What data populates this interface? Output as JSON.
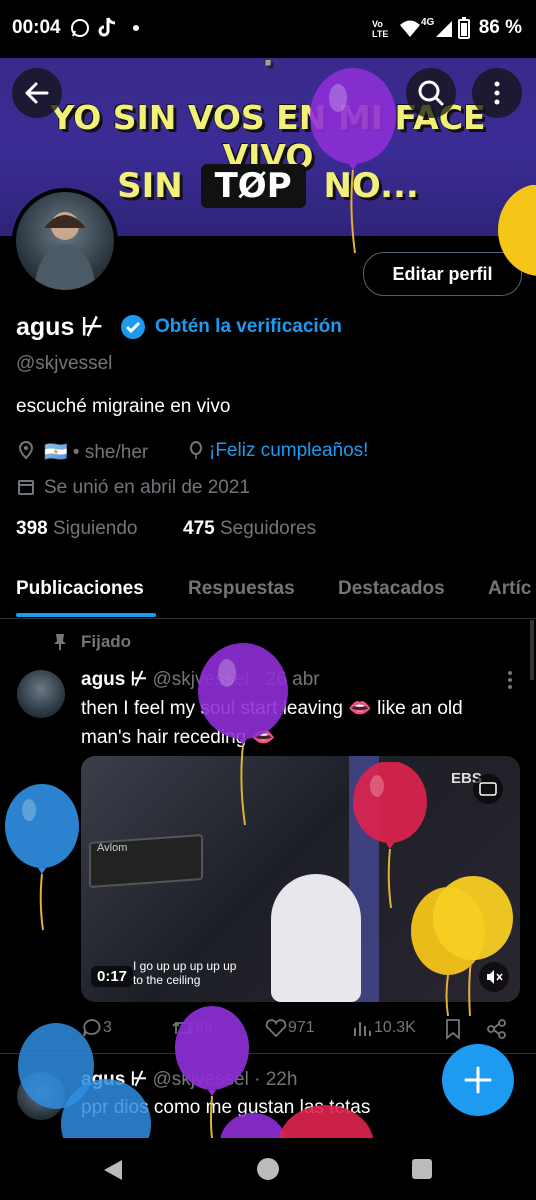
{
  "status_bar": {
    "time": "00:04",
    "network": "4G",
    "battery": "86 %",
    "volte_label": "Vo LTE"
  },
  "banner": {
    "line1": "YO SIN VOS EN MI FACE VIVO",
    "line2a": "SIN",
    "line2b": "TØP",
    "line2c": "NO..."
  },
  "profile": {
    "display_name": "agus ⊬",
    "verification_cta": "Obtén la verificación",
    "handle": "@skjvessel",
    "bio": "escuché migraine en vivo",
    "location": "🇦🇷 • she/her",
    "birthday": "¡Feliz cumpleaños!",
    "joined": "Se unió en abril de 2021",
    "following_count": "398",
    "following_label": "Siguiendo",
    "followers_count": "475",
    "followers_label": "Seguidores",
    "edit_label": "Editar perfil"
  },
  "tabs": [
    {
      "label": "Publicaciones"
    },
    {
      "label": "Respuestas"
    },
    {
      "label": "Destacados"
    },
    {
      "label": "Artíc"
    }
  ],
  "pinned_label": "Fijado",
  "tweets": [
    {
      "name": "agus ⊬",
      "handle": "@skjvessel",
      "date": "· 26 abr",
      "text_line1": "then I feel my soul start leaving 👄 like an old",
      "text_line2": "man's hair receding 👄",
      "media": {
        "badge": "EBS",
        "duration": "0:17",
        "caption1": "I go up up up up up",
        "caption2": "to the ceiling",
        "brand": "Avlom"
      },
      "replies": "3",
      "retweets": "89",
      "likes": "971",
      "views": "10.3K"
    },
    {
      "name": "agus ⊬",
      "handle": "@skjvessel",
      "date": "· 22h",
      "text_line1": "ppr dios como me gustan las tetas"
    }
  ],
  "colors": {
    "accent": "#1d9bf0",
    "background": "#000000",
    "muted": "#71767b"
  }
}
